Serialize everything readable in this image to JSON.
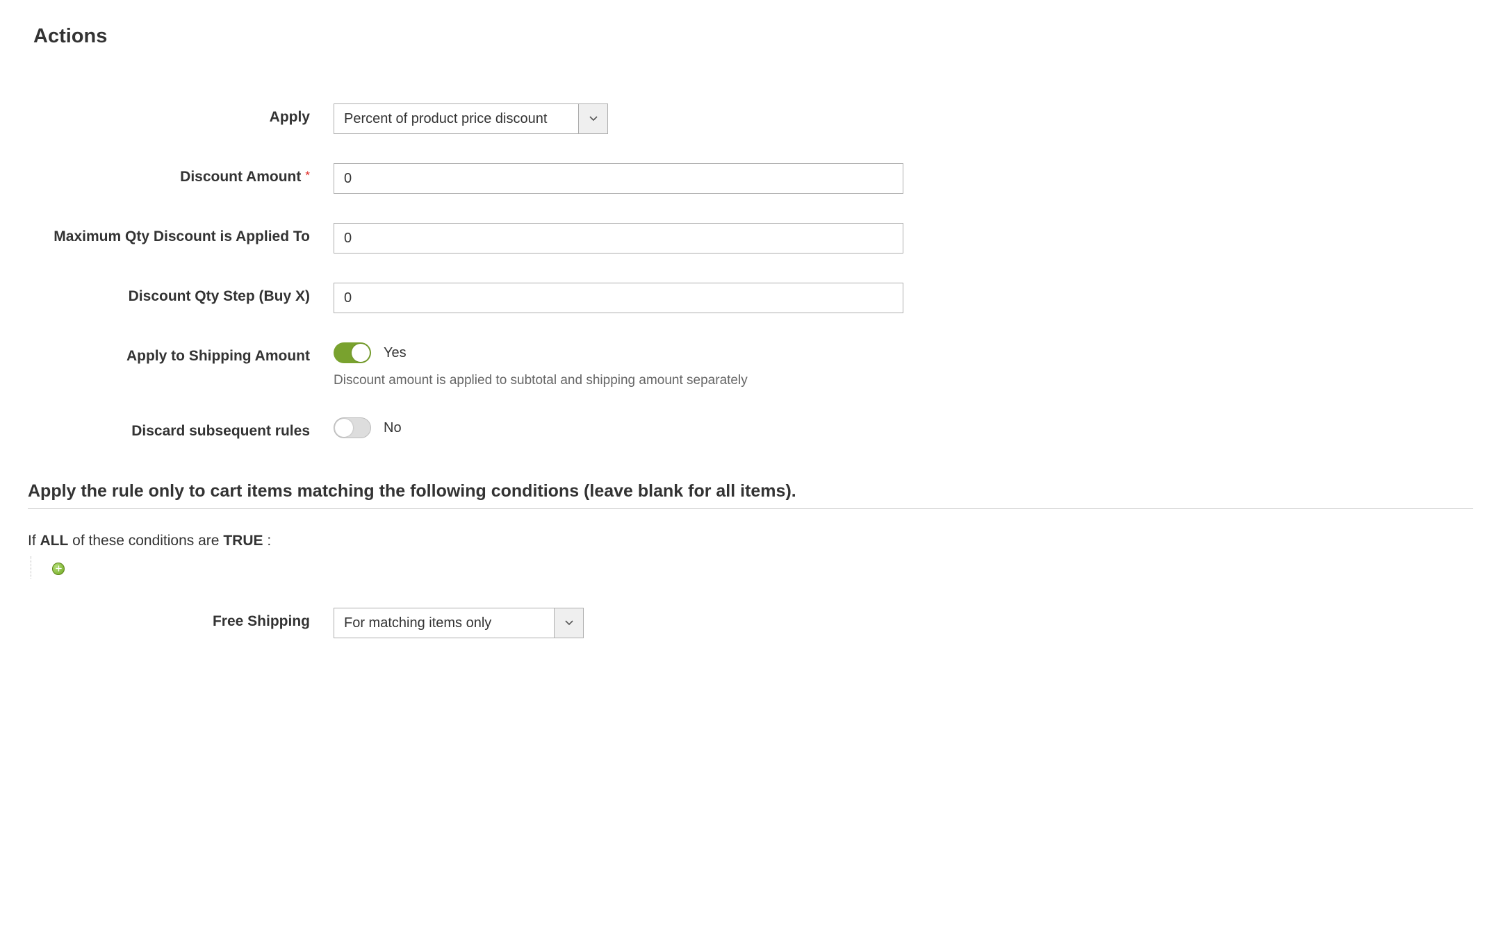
{
  "section": {
    "title": "Actions"
  },
  "form": {
    "apply": {
      "label": "Apply",
      "value": "Percent of product price discount"
    },
    "discount_amount": {
      "label": "Discount Amount",
      "value": "0",
      "required": true
    },
    "max_qty": {
      "label": "Maximum Qty Discount is Applied To",
      "value": "0"
    },
    "qty_step": {
      "label": "Discount Qty Step (Buy X)",
      "value": "0"
    },
    "apply_shipping": {
      "label": "Apply to Shipping Amount",
      "value_label": "Yes",
      "help": "Discount amount is applied to subtotal and shipping amount separately"
    },
    "discard_rules": {
      "label": "Discard subsequent rules",
      "value_label": "No"
    },
    "free_shipping": {
      "label": "Free Shipping",
      "value": "For matching items only"
    }
  },
  "conditions": {
    "heading": "Apply the rule only to cart items matching the following conditions (leave blank for all items).",
    "prefix_if": "If ",
    "aggregator": "ALL",
    "mid": "  of these conditions are ",
    "value": "TRUE",
    "suffix": " :"
  }
}
